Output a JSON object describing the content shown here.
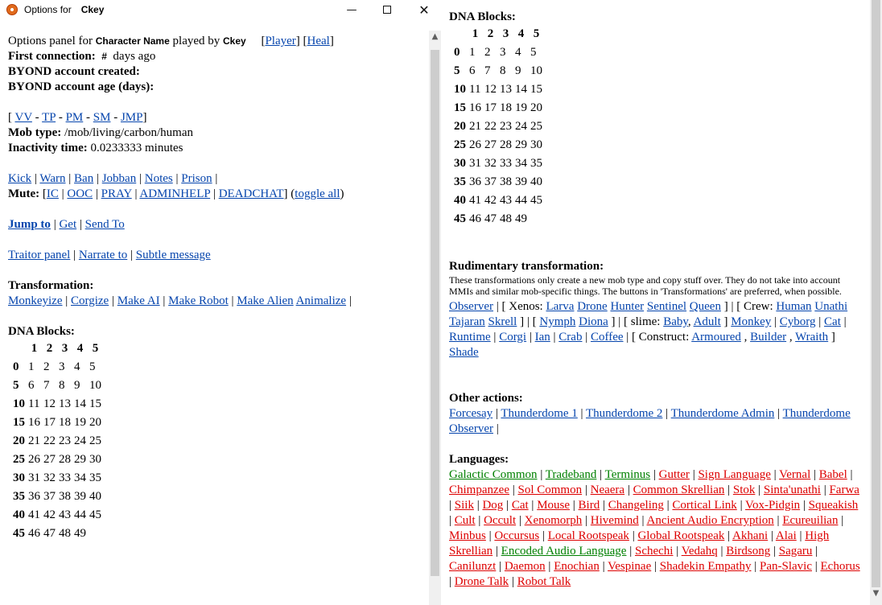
{
  "window": {
    "title_prefix": "Options for",
    "title_ckey": "Ckey",
    "minimize_icon": "minimize-icon",
    "maximize_icon": "maximize-icon",
    "close_icon": "close-icon"
  },
  "left": {
    "options_panel_for": "Options panel for",
    "character_name": "Character Name",
    "played_by": "played by",
    "ckey": "Ckey",
    "player_link": "Player",
    "heal_link": "Heal",
    "first_connection_label": "First connection:",
    "first_connection_value": "#",
    "first_connection_suffix": "days ago",
    "account_created_label": "BYOND account created:",
    "account_age_label": "BYOND account age (days):",
    "quick_links": [
      "VV",
      "TP",
      "PM",
      "SM",
      "JMP"
    ],
    "mob_type_label": "Mob type:",
    "mob_type_value": "/mob/living/carbon/human",
    "inactivity_label": "Inactivity time:",
    "inactivity_value": "0.0233333 minutes",
    "admin_actions": [
      "Kick",
      "Warn",
      "Ban",
      "Jobban",
      "Notes",
      "Prison"
    ],
    "mute_label": "Mute:",
    "mute_options": [
      "IC",
      "OOC",
      "PRAY",
      "ADMINHELP",
      "DEADCHAT"
    ],
    "toggle_all": "toggle all",
    "jump_to": "Jump to",
    "get": "Get",
    "send_to": "Send To",
    "traitor_panel": "Traitor panel",
    "narrate_to": "Narrate to",
    "subtle_message": "Subtle message",
    "transformation_label": "Transformation:",
    "transformations": [
      "Monkeyize",
      "Corgize",
      "Make AI",
      "Make Robot",
      "Make Alien",
      "Animalize"
    ],
    "dna_label": "DNA Blocks:"
  },
  "dna": {
    "col_headers": [
      "1",
      "2",
      "3",
      "4",
      "5"
    ],
    "rows": [
      {
        "h": "0",
        "c": [
          "1",
          "2",
          "3",
          "4",
          "5"
        ]
      },
      {
        "h": "5",
        "c": [
          "6",
          "7",
          "8",
          "9",
          "10"
        ]
      },
      {
        "h": "10",
        "c": [
          "11",
          "12",
          "13",
          "14",
          "15"
        ]
      },
      {
        "h": "15",
        "c": [
          "16",
          "17",
          "18",
          "19",
          "20"
        ]
      },
      {
        "h": "20",
        "c": [
          "21",
          "22",
          "23",
          "24",
          "25"
        ]
      },
      {
        "h": "25",
        "c": [
          "26",
          "27",
          "28",
          "29",
          "30"
        ]
      },
      {
        "h": "30",
        "c": [
          "31",
          "32",
          "33",
          "34",
          "35"
        ]
      },
      {
        "h": "35",
        "c": [
          "36",
          "37",
          "38",
          "39",
          "40"
        ]
      },
      {
        "h": "40",
        "c": [
          "41",
          "42",
          "43",
          "44",
          "45"
        ]
      },
      {
        "h": "45",
        "c": [
          "46",
          "47",
          "48",
          "49",
          ""
        ]
      }
    ]
  },
  "right": {
    "dna_label": "DNA Blocks:",
    "rudimentary_label": "Rudimentary transformation:",
    "rudimentary_desc": "These transformations only create a new mob type and copy stuff over. They do not take into account MMIs and similar mob-specific things. The buttons in 'Transformations' are preferred, when possible.",
    "observer": "Observer",
    "xenos_label": "Xenos:",
    "xenos": [
      "Larva",
      "Drone",
      "Hunter",
      "Sentinel",
      "Queen"
    ],
    "crew_label": "Crew:",
    "crew": [
      "Human",
      "Unathi",
      "Tajaran",
      "Skrell"
    ],
    "nymph": "Nymph",
    "diona": "Diona",
    "slime_label": "slime:",
    "baby": "Baby",
    "adult": "Adult",
    "misc_mobs": [
      "Monkey",
      "Cyborg",
      "Cat",
      "Runtime",
      "Corgi",
      "Ian",
      "Crab",
      "Coffee"
    ],
    "construct_label": "Construct:",
    "constructs": [
      "Armoured",
      "Builder",
      "Wraith"
    ],
    "shade": "Shade",
    "other_actions_label": "Other actions:",
    "other_actions": [
      "Forcesay",
      "Thunderdome 1",
      "Thunderdome 2",
      "Thunderdome Admin",
      "Thunderdome Observer"
    ],
    "languages_label": "Languages:",
    "languages": [
      {
        "name": "Galactic Common",
        "known": true
      },
      {
        "name": "Tradeband",
        "known": true
      },
      {
        "name": "Terminus",
        "known": true
      },
      {
        "name": "Gutter",
        "known": false
      },
      {
        "name": "Sign Language",
        "known": false
      },
      {
        "name": "Vernal",
        "known": false
      },
      {
        "name": "Babel",
        "known": false
      },
      {
        "name": "Chimpanzee",
        "known": false
      },
      {
        "name": "Sol Common",
        "known": false
      },
      {
        "name": "Neaera",
        "known": false
      },
      {
        "name": "Common Skrellian",
        "known": false
      },
      {
        "name": "Stok",
        "known": false
      },
      {
        "name": "Sinta'unathi",
        "known": false
      },
      {
        "name": "Farwa",
        "known": false
      },
      {
        "name": "Siik",
        "known": false
      },
      {
        "name": "Dog",
        "known": false
      },
      {
        "name": "Cat",
        "known": false
      },
      {
        "name": "Mouse",
        "known": false
      },
      {
        "name": "Bird",
        "known": false
      },
      {
        "name": "Changeling",
        "known": false
      },
      {
        "name": "Cortical Link",
        "known": false
      },
      {
        "name": "Vox-Pidgin",
        "known": false
      },
      {
        "name": "Squeakish",
        "known": false
      },
      {
        "name": "Cult",
        "known": false
      },
      {
        "name": "Occult",
        "known": false
      },
      {
        "name": "Xenomorph",
        "known": false
      },
      {
        "name": "Hivemind",
        "known": false
      },
      {
        "name": "Ancient Audio Encryption",
        "known": false
      },
      {
        "name": "Ecureuilian",
        "known": false
      },
      {
        "name": "Minbus",
        "known": false
      },
      {
        "name": "Occursus",
        "known": false
      },
      {
        "name": "Local Rootspeak",
        "known": false
      },
      {
        "name": "Global Rootspeak",
        "known": false
      },
      {
        "name": "Akhani",
        "known": false
      },
      {
        "name": "Alai",
        "known": false
      },
      {
        "name": "High Skrellian",
        "known": false
      },
      {
        "name": "Encoded Audio Language",
        "known": true
      },
      {
        "name": "Schechi",
        "known": false
      },
      {
        "name": "Vedahq",
        "known": false
      },
      {
        "name": "Birdsong",
        "known": false
      },
      {
        "name": "Sagaru",
        "known": false
      },
      {
        "name": "Canilunzt",
        "known": false
      },
      {
        "name": "Daemon",
        "known": false
      },
      {
        "name": "Enochian",
        "known": false
      },
      {
        "name": "Vespinae",
        "known": false
      },
      {
        "name": "Shadekin Empathy",
        "known": false
      },
      {
        "name": "Pan-Slavic",
        "known": false
      },
      {
        "name": "Echorus",
        "known": false
      },
      {
        "name": "Drone Talk",
        "known": false
      },
      {
        "name": "Robot Talk",
        "known": false
      }
    ]
  },
  "colors": {
    "link": "#0645ad",
    "known_language": "#008000",
    "unknown_language": "#dd0000"
  }
}
